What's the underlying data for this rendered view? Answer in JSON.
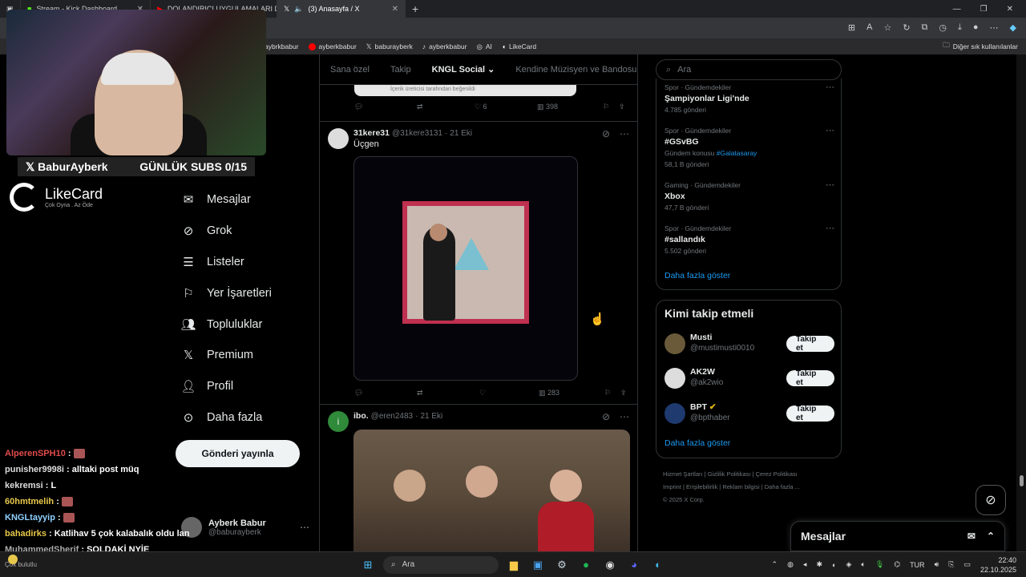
{
  "browser": {
    "tabs": [
      {
        "label": "Stream - Kick Dashboard"
      },
      {
        "label": "DOLANDIRICI UYGULAMALARI D"
      },
      {
        "label": "(3) Anasayfa / X"
      }
    ],
    "bookmarks": [
      {
        "label": "aybrkbabur"
      },
      {
        "label": "ayberkbabur"
      },
      {
        "label": "baburayberk"
      },
      {
        "label": "ayberkbabur"
      },
      {
        "label": "AI"
      },
      {
        "label": "LikeCard"
      }
    ],
    "other_bookmarks": "Diğer sık kullanılanlar"
  },
  "stream_overlay": {
    "handle": "BaburAyberk",
    "subs_goal": "GÜNLÜK SUBS 0/15",
    "sponsor_name": "LikeCard",
    "sponsor_tagline": "Çok Oyna . Az Öde"
  },
  "nav": [
    {
      "label": "Mesajlar",
      "icon": "mail-icon"
    },
    {
      "label": "Grok",
      "icon": "grok-icon"
    },
    {
      "label": "Listeler",
      "icon": "list-icon"
    },
    {
      "label": "Yer İşaretleri",
      "icon": "bookmark-icon"
    },
    {
      "label": "Topluluklar",
      "icon": "people-icon"
    },
    {
      "label": "Premium",
      "icon": "x-logo-icon"
    },
    {
      "label": "Profil",
      "icon": "person-icon"
    },
    {
      "label": "Daha fazla",
      "icon": "more-circle-icon"
    }
  ],
  "post_button": "Gönderi yayınla",
  "account": {
    "name": "Ayberk Babur",
    "handle": "@baburayberk"
  },
  "chat": [
    {
      "user": "AlperenSPH10",
      "msg": " : ",
      "color": "#e04a4a",
      "emote": true
    },
    {
      "user": "punisher9998i",
      "msg": " : alltaki post müq",
      "color": "#dddddd"
    },
    {
      "user": "kekremsi",
      "msg": " : L",
      "color": "#dddddd"
    },
    {
      "user": "60hmtmelih",
      "msg": " : ",
      "color": "#e8c84a",
      "emote": true
    },
    {
      "user": "KNGLtayyip",
      "msg": " : ",
      "color": "#8fd0ff",
      "emote": true
    },
    {
      "user": "bahadirks",
      "msg": " : Katlihav 5 çok kalabalık oldu lan",
      "color": "#e8c84a"
    },
    {
      "user": "MuhammedSherif",
      "msg": " : SOLDAKİ NYİE HOBBİTE BENZİO",
      "color": "#aaaaaa"
    }
  ],
  "feed_tabs": [
    "Sana özel",
    "Takip",
    "KNGL Social",
    "Kendine Müzisyen ve Bandosu"
  ],
  "tweets": [
    {
      "stats": {
        "replies": "",
        "retweets": "",
        "likes": "6",
        "views": "398"
      },
      "note": "İçerik üreticisi tarafından beğenildi"
    },
    {
      "name": "31kere31",
      "handle": "@31kere3131",
      "time": "21 Eki",
      "text": "Üçgen",
      "stats": {
        "replies": "",
        "retweets": "",
        "likes": "",
        "views": "283"
      }
    },
    {
      "name": "ibo.",
      "handle": "@eren2483",
      "time": "21 Eki",
      "avatar_letter": "i"
    }
  ],
  "search_placeholder": "Ara",
  "trends": [
    {
      "meta": "Spor · Gündemdekiler",
      "name": "Şampiyonlar Ligi'nde",
      "count": "4.785 gönderi"
    },
    {
      "meta": "Spor · Gündemdekiler",
      "name": "#GSvBG",
      "sub": "Gündem konusu",
      "tag": "#Galatasaray",
      "count": "58,1 B gönderi"
    },
    {
      "meta": "Gaming · Gündemdekiler",
      "name": "Xbox",
      "count": "47,7 B gönderi"
    },
    {
      "meta": "Spor · Gündemdekiler",
      "name": "#sallandık",
      "count": "5.502 gönderi"
    }
  ],
  "show_more": "Daha fazla göster",
  "who_to_follow": {
    "title": "Kimi takip etmeli",
    "users": [
      {
        "name": "Musti",
        "handle": "@mustimusti0010"
      },
      {
        "name": "AK2W",
        "handle": "@ak2wio"
      },
      {
        "name": "BPT",
        "handle": "@bpthaber",
        "verified": true
      }
    ],
    "follow_label": "Takip et",
    "show_more": "Daha fazla göster"
  },
  "footer": {
    "links": [
      "Hizmet Şartları",
      "Gizlilik Politikası",
      "Çerez Politikası",
      "Imprint",
      "Erişilebilirlik",
      "Reklam bilgisi",
      "Daha fazla ..."
    ],
    "copyright": "© 2025 X Corp."
  },
  "messages_drawer": "Mesajlar",
  "taskbar": {
    "search": "Ara",
    "weather": "Çok bulutlu",
    "lang": "TUR",
    "time": "22:40",
    "date": "22.10.2025"
  }
}
